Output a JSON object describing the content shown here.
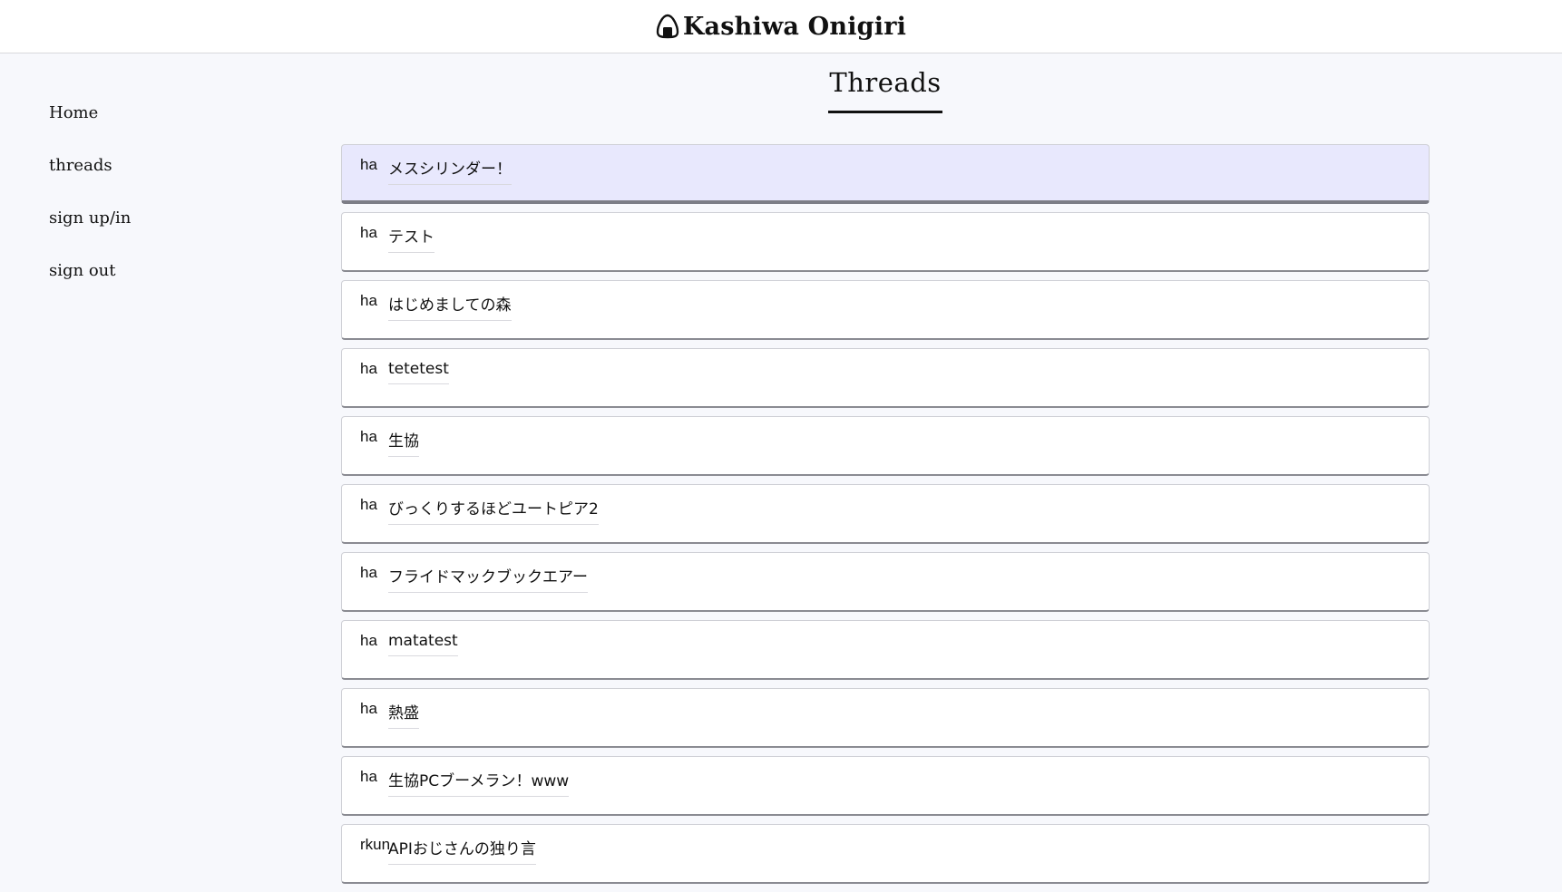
{
  "header": {
    "logo_icon": "onigiri-icon",
    "brand": "Kashiwa Onigiri"
  },
  "sidebar": {
    "items": [
      {
        "label": "Home"
      },
      {
        "label": "threads"
      },
      {
        "label": "sign up/in"
      },
      {
        "label": "sign out"
      }
    ]
  },
  "main": {
    "title": "Threads",
    "threads": [
      {
        "author": "ha",
        "title": "メスシリンダー！",
        "active": true
      },
      {
        "author": "ha",
        "title": "テスト"
      },
      {
        "author": "ha",
        "title": "はじめましての森"
      },
      {
        "author": "ha",
        "title": "tetetest"
      },
      {
        "author": "ha",
        "title": "生協"
      },
      {
        "author": "ha",
        "title": "びっくりするほどユートピア2"
      },
      {
        "author": "ha",
        "title": "フライドマックブックエアー"
      },
      {
        "author": "ha",
        "title": "matatest"
      },
      {
        "author": "ha",
        "title": "熱盛"
      },
      {
        "author": "ha",
        "title": "生協PCブーメラン！www"
      },
      {
        "author": "rkun",
        "title": "APIおじさんの独り言"
      }
    ]
  },
  "colors": {
    "page_background": "#f7f8fc",
    "active_thread_background": "#e8e8fd",
    "card_background": "#ffffff"
  }
}
